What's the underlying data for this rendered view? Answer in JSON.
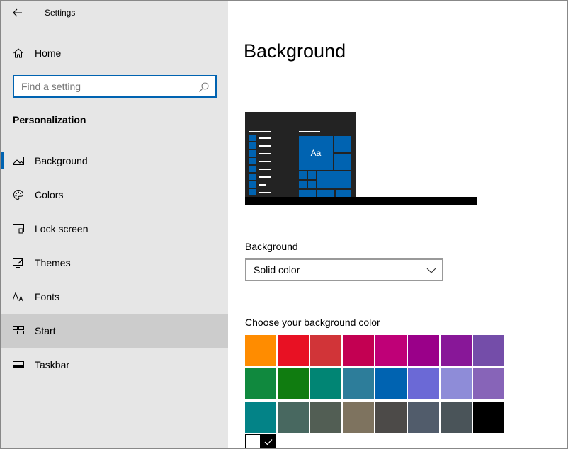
{
  "window": {
    "title": "Settings"
  },
  "sidebar": {
    "home_label": "Home",
    "search_placeholder": "Find a setting",
    "section_title": "Personalization",
    "items": [
      {
        "label": "Background",
        "icon": "picture-icon"
      },
      {
        "label": "Colors",
        "icon": "palette-icon"
      },
      {
        "label": "Lock screen",
        "icon": "lock-screen-icon"
      },
      {
        "label": "Themes",
        "icon": "themes-icon"
      },
      {
        "label": "Fonts",
        "icon": "fonts-icon"
      },
      {
        "label": "Start",
        "icon": "start-icon"
      },
      {
        "label": "Taskbar",
        "icon": "taskbar-icon"
      }
    ],
    "selected": "Background",
    "hovered": "Start"
  },
  "main": {
    "title": "Background",
    "preview_text": "Aa",
    "background_label": "Background",
    "background_value": "Solid color",
    "color_label": "Choose your background color",
    "colors": [
      "#FF8C00",
      "#E81123",
      "#D13438",
      "#C30052",
      "#BF0077",
      "#9A0089",
      "#881798",
      "#744DA9",
      "#10893E",
      "#107C10",
      "#018574",
      "#2D7D9A",
      "#0063B1",
      "#6B69D6",
      "#8E8CD8",
      "#8764B8",
      "#038387",
      "#486860",
      "#525E54",
      "#7E735F",
      "#4C4A48",
      "#515C6B",
      "#4A5459",
      "#000000"
    ],
    "custom_colors": [
      "#FFFFFF",
      "#000000"
    ]
  },
  "accent_color": "#0063B1"
}
